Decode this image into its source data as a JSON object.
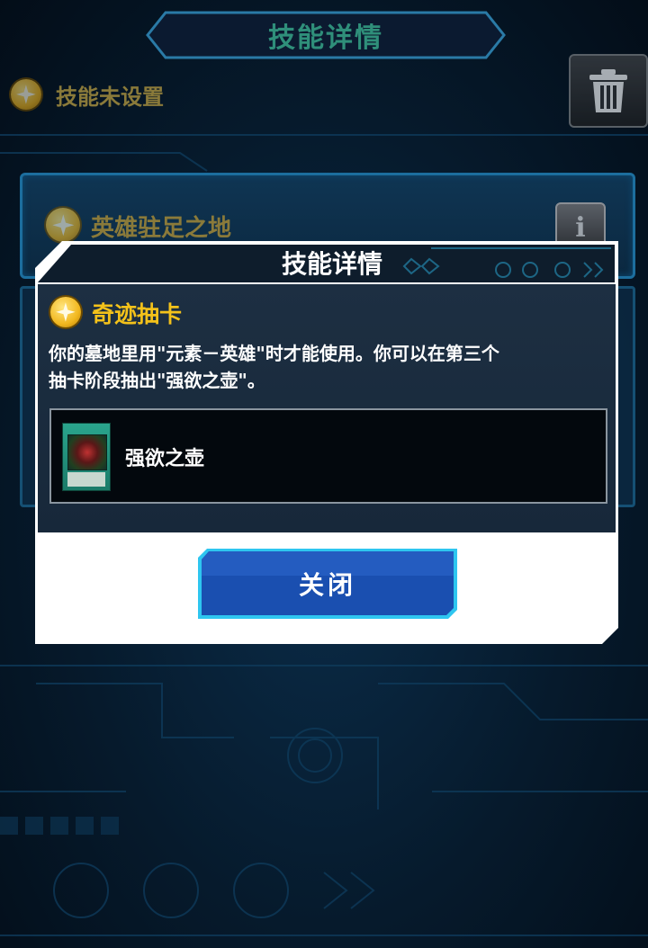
{
  "screen": {
    "title": "技能详情"
  },
  "skill_list": {
    "unset_label": "技能未设置",
    "hero_skill_label": "英雄驻足之地"
  },
  "modal": {
    "title": "技能详情",
    "skill_name": "奇迹抽卡",
    "description_line1": "你的墓地里用\"元素－英雄\"时才能使用。你可以在第三个",
    "description_line2": "抽卡阶段抽出\"强欲之壶\"。",
    "card_name": "强欲之壶",
    "close_label": "关闭"
  },
  "colors": {
    "accent_gold": "#f4c21a",
    "modal_body": "#1d2f42",
    "button_blue": "#1a4fb0"
  },
  "icons": [
    "star-icon",
    "trash-icon",
    "info-icon"
  ]
}
